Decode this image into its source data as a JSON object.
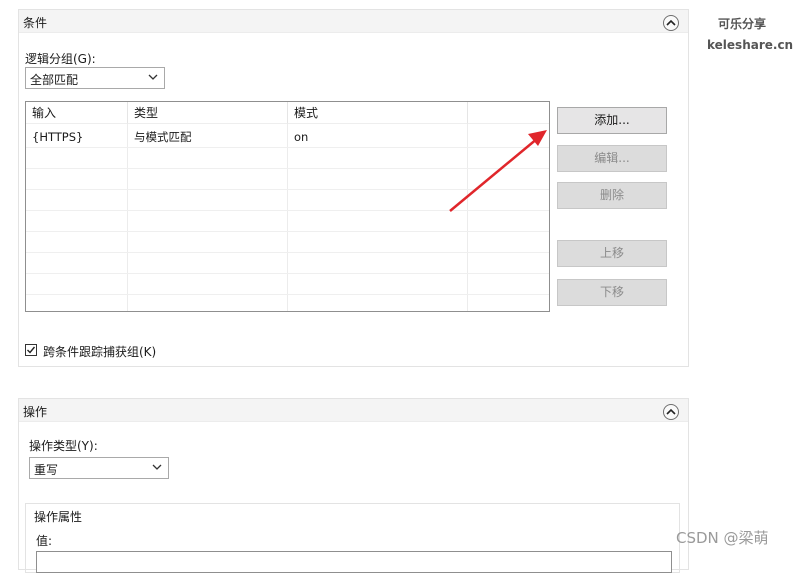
{
  "conditions": {
    "title": "条件",
    "logical_grouping_label": "逻辑分组(G):",
    "logical_grouping_value": "全部匹配",
    "table": {
      "columns": [
        "输入",
        "类型",
        "模式"
      ],
      "rows": [
        [
          "{HTTPS}",
          "与模式匹配",
          "on"
        ]
      ]
    },
    "buttons": {
      "add": "添加...",
      "edit": "编辑...",
      "delete": "删除",
      "move_up": "上移",
      "move_down": "下移"
    },
    "track_captures_label": "跨条件跟踪捕获组(K)",
    "track_captures_checked": true
  },
  "action": {
    "title": "操作",
    "action_type_label": "操作类型(Y):",
    "action_type_value": "重写",
    "properties_title": "操作属性",
    "value_label": "值:"
  },
  "watermarks": {
    "top_line1": "可乐分享",
    "top_line2": "keleshare.cn",
    "bottom": "CSDN @梁萌"
  },
  "annotation_color": "#e0262b",
  "icons": [
    "collapse-up-icon",
    "chevron-down-icon",
    "checkmark-icon",
    "red-arrow-annotation"
  ]
}
